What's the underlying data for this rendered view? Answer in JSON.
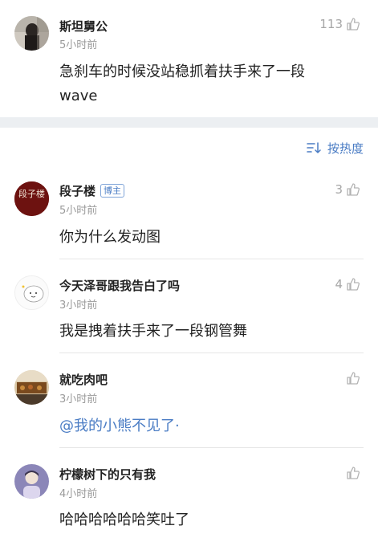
{
  "top_comment": {
    "user": "斯坦舅公",
    "time": "5小时前",
    "likes": "113",
    "content_line1": "急刹车的时候没站稳抓着扶手来了一段",
    "content_line2": "wave"
  },
  "sort": {
    "label": "按热度"
  },
  "comments": [
    {
      "user": "段子楼",
      "badge": "博主",
      "time": "5小时前",
      "likes": "3",
      "content": "你为什么发动图"
    },
    {
      "user": "今天泽哥跟我告白了吗",
      "time": "3小时前",
      "likes": "4",
      "content": "我是拽着扶手来了一段钢管舞"
    },
    {
      "user": "就吃肉吧",
      "time": "3小时前",
      "likes": "",
      "content": "@我的小熊不见了·"
    },
    {
      "user": "柠檬树下的只有我",
      "time": "4小时前",
      "likes": "",
      "content": "哈哈哈哈哈哈笑吐了"
    }
  ],
  "avatar_texts": {
    "duanzilou": "段子楼"
  },
  "colors": {
    "link": "#4a7cc4",
    "meta": "#9a9a9a",
    "gap": "#eceff2"
  }
}
